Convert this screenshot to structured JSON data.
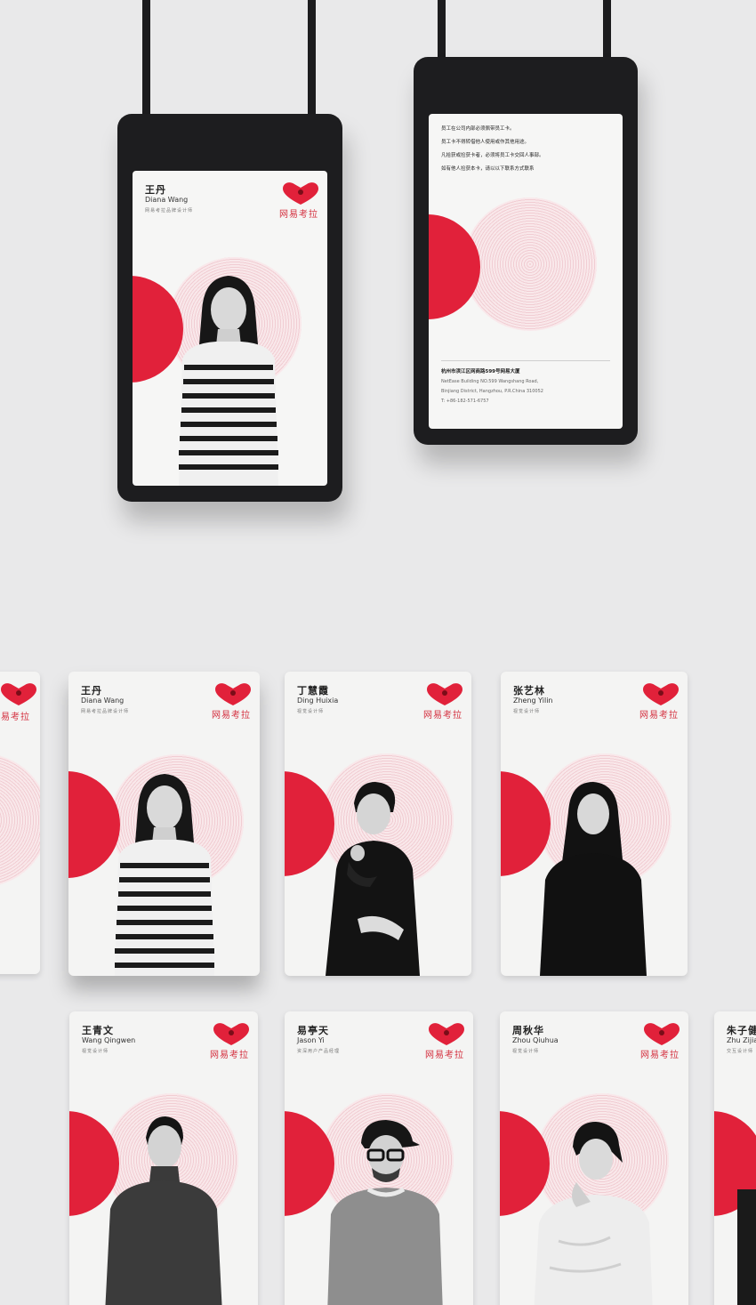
{
  "brand": {
    "logo_text": "网易考拉",
    "accent_color": "#e1213a",
    "ring_color": "#f1cbd1"
  },
  "featured_badge": {
    "name_cn": "王丹",
    "name_en": "Diana Wang",
    "role": "网易考拉品牌设计师",
    "outfit": "striped-sweater"
  },
  "back_card": {
    "lines": [
      "员工在公司内部必须佩带员工卡。",
      "员工卡不得转借他人使用或作其他用途。",
      "凡拾获或捡获卡者，必须将员工卡交回人事部。",
      "如有他人捡获本卡，请以以下联系方式联系"
    ],
    "address_cn": "杭州市滨江区网商路599号网易大厦",
    "address_en_1": "NetEase Building NO.599 Wangshang Road,",
    "address_en_2": "Binjiang District, Hangzhou, P.R.China 310052",
    "phone": "T: +86-182-571-6757"
  },
  "cards": [
    {
      "name_cn": "王丹",
      "name_en": "Diana Wang",
      "role": "网易考拉品牌设计师",
      "outfit": "striped-sweater"
    },
    {
      "name_cn": "丁慧霞",
      "name_en": "Ding Huixia",
      "role": "视觉设计师",
      "outfit": "black-sweater"
    },
    {
      "name_cn": "张艺林",
      "name_en": "Zheng Yilin",
      "role": "视觉设计师",
      "outfit": "black-top"
    },
    {
      "name_cn": "王青文",
      "name_en": "Wang Qingwen",
      "role": "视觉设计师",
      "outfit": "dark-knit"
    },
    {
      "name_cn": "易亭天",
      "name_en": "Jason Yi",
      "role": "资深用户产品经理",
      "outfit": "grey-sweater"
    },
    {
      "name_cn": "周秋华",
      "name_en": "Zhou Qiuhua",
      "role": "视觉设计师",
      "outfit": "white-sweater"
    },
    {
      "name_cn": "朱子健",
      "name_en": "Zhu Zijian",
      "role": "交互设计师",
      "outfit": "dark"
    }
  ]
}
